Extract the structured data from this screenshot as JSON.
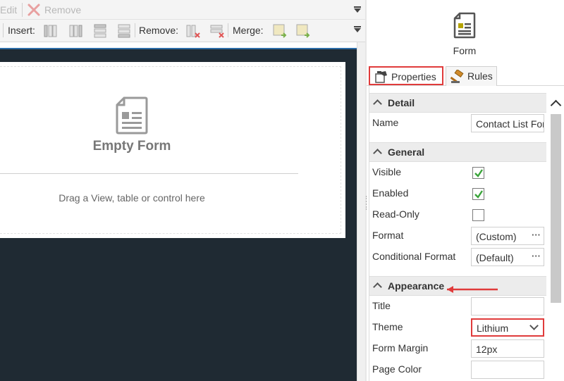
{
  "toolbar": {
    "row1": {
      "edit_label": "Edit",
      "remove_label": "Remove"
    },
    "row2": {
      "insert_label": "Insert:",
      "remove_label": "Remove:",
      "merge_label": "Merge:"
    }
  },
  "designer": {
    "empty_form": {
      "title": "Empty Form",
      "hint": "Drag a View, table or control here"
    }
  },
  "panel": {
    "title": "Form",
    "tabs": [
      {
        "label": "Properties",
        "active": true
      },
      {
        "label": "Rules",
        "active": false
      }
    ],
    "sections": {
      "detail": {
        "label": "Detail",
        "name_label": "Name",
        "name_value": "Contact List Form"
      },
      "general": {
        "label": "General",
        "visible_label": "Visible",
        "visible_checked": true,
        "enabled_label": "Enabled",
        "enabled_checked": true,
        "readonly_label": "Read-Only",
        "readonly_checked": false,
        "format_label": "Format",
        "format_value": "(Custom)",
        "conditional_label": "Conditional Format",
        "conditional_value": "(Default)",
        "ellipsis": "···"
      },
      "appearance": {
        "label": "Appearance",
        "title_label": "Title",
        "title_value": "",
        "theme_label": "Theme",
        "theme_value": "Lithium",
        "margin_label": "Form Margin",
        "margin_value": "12px",
        "pagecolor_label": "Page Color",
        "pagecolor_value": ""
      }
    }
  },
  "colors": {
    "canvas_bg": "#1f2a33",
    "highlight_red": "#e03b3b",
    "check_green": "#3aa43a"
  }
}
